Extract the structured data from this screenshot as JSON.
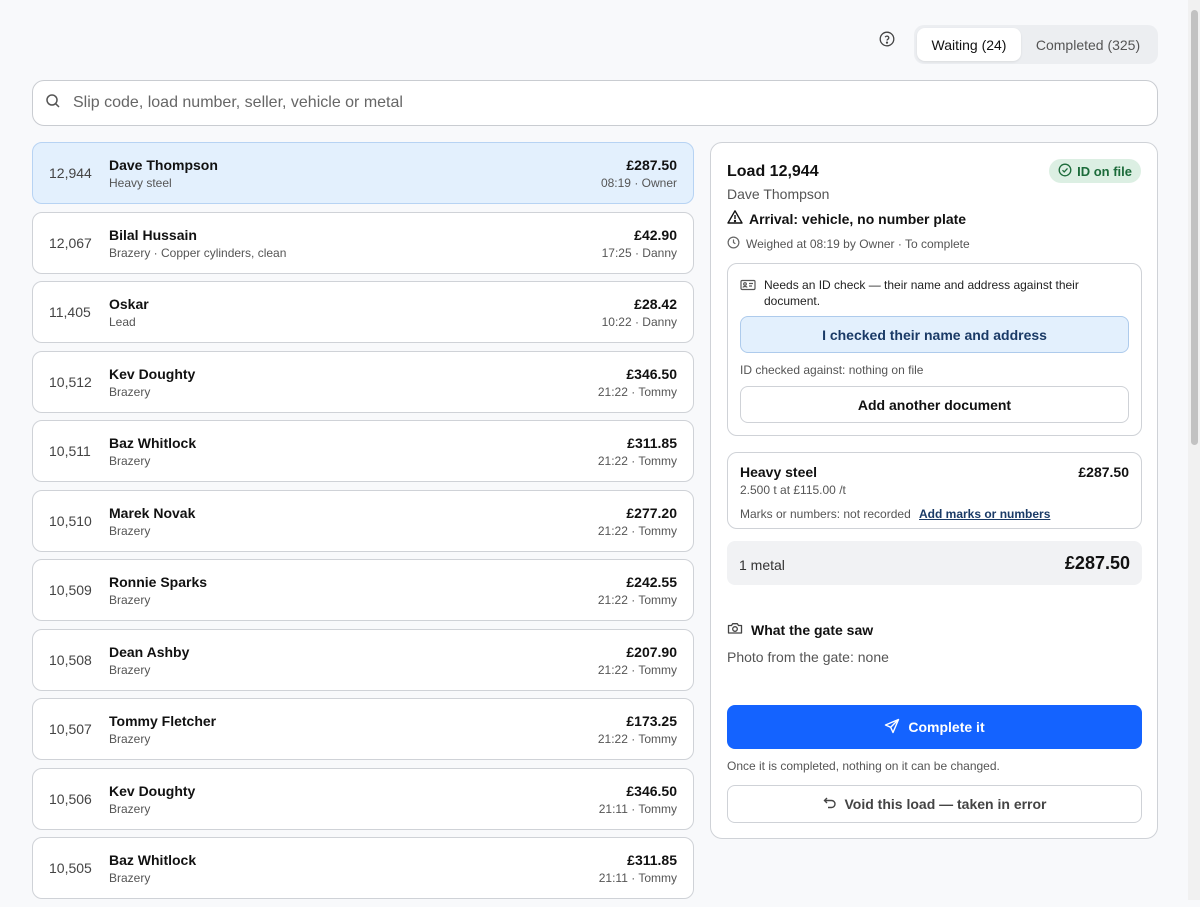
{
  "header": {
    "help_icon": "help-circle-icon",
    "tabs": [
      {
        "label": "Waiting (24)",
        "active": true
      },
      {
        "label": "Completed (325)",
        "active": false
      }
    ]
  },
  "search": {
    "placeholder": "Slip code, load number, seller, vehicle or metal",
    "value": ""
  },
  "loads": [
    {
      "number": "12,944",
      "seller": "Dave Thompson",
      "metal": "Heavy steel",
      "amount": "£287.50",
      "meta": "08:19 · Owner",
      "selected": true
    },
    {
      "number": "12,067",
      "seller": "Bilal Hussain",
      "metal": "Brazery · Copper cylinders, clean",
      "amount": "£42.90",
      "meta": "17:25 · Danny"
    },
    {
      "number": "11,405",
      "seller": "Oskar",
      "metal": "Lead",
      "amount": "£28.42",
      "meta": "10:22 · Danny"
    },
    {
      "number": "10,512",
      "seller": "Kev Doughty",
      "metal": "Brazery",
      "amount": "£346.50",
      "meta": "21:22 · Tommy"
    },
    {
      "number": "10,511",
      "seller": "Baz Whitlock",
      "metal": "Brazery",
      "amount": "£311.85",
      "meta": "21:22 · Tommy"
    },
    {
      "number": "10,510",
      "seller": "Marek Novak",
      "metal": "Brazery",
      "amount": "£277.20",
      "meta": "21:22 · Tommy"
    },
    {
      "number": "10,509",
      "seller": "Ronnie Sparks",
      "metal": "Brazery",
      "amount": "£242.55",
      "meta": "21:22 · Tommy"
    },
    {
      "number": "10,508",
      "seller": "Dean Ashby",
      "metal": "Brazery",
      "amount": "£207.90",
      "meta": "21:22 · Tommy"
    },
    {
      "number": "10,507",
      "seller": "Tommy Fletcher",
      "metal": "Brazery",
      "amount": "£173.25",
      "meta": "21:22 · Tommy"
    },
    {
      "number": "10,506",
      "seller": "Kev Doughty",
      "metal": "Brazery",
      "amount": "£346.50",
      "meta": "21:11 · Tommy"
    },
    {
      "number": "10,505",
      "seller": "Baz Whitlock",
      "metal": "Brazery",
      "amount": "£311.85",
      "meta": "21:11 · Tommy"
    }
  ],
  "detail": {
    "title": "Load 12,944",
    "badge": "ID on file",
    "seller": "Dave Thompson",
    "arrival": "Arrival: vehicle, no number plate",
    "weighed": "Weighed at 08:19 by Owner · To complete",
    "id_check": {
      "prompt": "Needs an ID check — their name and address against their document.",
      "confirm_button": "I checked their name and address",
      "checked_against": "ID checked against: nothing on file",
      "add_document_button": "Add another document"
    },
    "metal_line": {
      "name": "Heavy steel",
      "amount": "£287.50",
      "rate": "2.500 t at £115.00 /t",
      "marks": "Marks or numbers: not recorded",
      "marks_link": "Add marks or numbers"
    },
    "totals": {
      "count": "1 metal",
      "total": "£287.50"
    },
    "gate": {
      "heading": "What the gate saw",
      "photo": "Photo from the gate: none"
    },
    "complete_button": "Complete it",
    "complete_note": "Once it is completed, nothing on it can be changed.",
    "void_button": "Void this load — taken in error"
  },
  "colors": {
    "accent": "#1463ff",
    "selected_row": "#e3f0fd",
    "badge_bg": "#dcefe3",
    "badge_fg": "#1c6b3a"
  }
}
